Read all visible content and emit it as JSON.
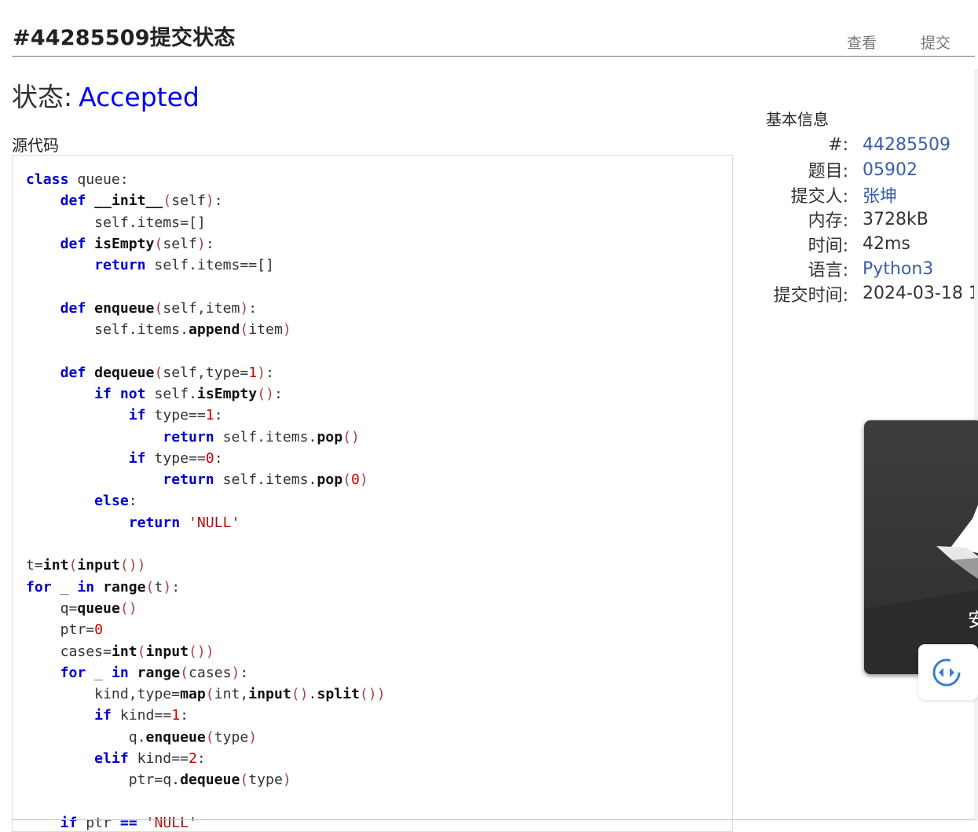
{
  "header": {
    "title": "#44285509提交状态",
    "links": [
      "查看",
      "提交"
    ]
  },
  "status": {
    "label": "状态:",
    "value": "Accepted"
  },
  "source_label": "源代码",
  "info": {
    "title": "基本信息",
    "rows": [
      {
        "label": "#:",
        "value": "44285509",
        "link": true
      },
      {
        "label": "题目:",
        "value": "05902",
        "link": true
      },
      {
        "label": "提交人:",
        "value": "张坤",
        "link": true
      },
      {
        "label": "内存:",
        "value": "3728kB",
        "link": false
      },
      {
        "label": "时间:",
        "value": "42ms",
        "link": false
      },
      {
        "label": "语言:",
        "value": "Python3",
        "link": true
      },
      {
        "label": "提交时间:",
        "value": "2024-03-18 1",
        "link": false
      }
    ]
  },
  "overlay": {
    "partial_text": "安"
  },
  "code_lines": [
    [
      [
        "kw",
        "class"
      ],
      [
        "t",
        " queue:"
      ]
    ],
    [
      [
        "t",
        "    "
      ],
      [
        "kw",
        "def"
      ],
      [
        "t",
        " "
      ],
      [
        "fn",
        "__init__"
      ],
      [
        "p",
        "("
      ],
      [
        "t",
        "self"
      ],
      [
        "p",
        ")"
      ],
      [
        "t",
        ":"
      ]
    ],
    [
      [
        "t",
        "        self.items=[]"
      ]
    ],
    [
      [
        "t",
        "    "
      ],
      [
        "kw",
        "def"
      ],
      [
        "t",
        " "
      ],
      [
        "fn",
        "isEmpty"
      ],
      [
        "p",
        "("
      ],
      [
        "t",
        "self"
      ],
      [
        "p",
        ")"
      ],
      [
        "t",
        ":"
      ]
    ],
    [
      [
        "t",
        "        "
      ],
      [
        "kw",
        "return"
      ],
      [
        "t",
        " self.items==[]"
      ]
    ],
    [
      [
        "t",
        ""
      ]
    ],
    [
      [
        "t",
        "    "
      ],
      [
        "kw",
        "def"
      ],
      [
        "t",
        " "
      ],
      [
        "fn",
        "enqueue"
      ],
      [
        "p",
        "("
      ],
      [
        "t",
        "self,item"
      ],
      [
        "p",
        ")"
      ],
      [
        "t",
        ":"
      ]
    ],
    [
      [
        "t",
        "        self.items."
      ],
      [
        "fn",
        "append"
      ],
      [
        "p",
        "("
      ],
      [
        "t",
        "item"
      ],
      [
        "p",
        ")"
      ]
    ],
    [
      [
        "t",
        ""
      ]
    ],
    [
      [
        "t",
        "    "
      ],
      [
        "kw",
        "def"
      ],
      [
        "t",
        " "
      ],
      [
        "fn",
        "dequeue"
      ],
      [
        "p",
        "("
      ],
      [
        "t",
        "self,type="
      ],
      [
        "num",
        "1"
      ],
      [
        "p",
        ")"
      ],
      [
        "t",
        ":"
      ]
    ],
    [
      [
        "t",
        "        "
      ],
      [
        "kw",
        "if"
      ],
      [
        "t",
        " "
      ],
      [
        "kw",
        "not"
      ],
      [
        "t",
        " self."
      ],
      [
        "fn",
        "isEmpty"
      ],
      [
        "p",
        "()"
      ],
      [
        "t",
        ":"
      ]
    ],
    [
      [
        "t",
        "            "
      ],
      [
        "kw",
        "if"
      ],
      [
        "t",
        " type=="
      ],
      [
        "num",
        "1"
      ],
      [
        "t",
        ":"
      ]
    ],
    [
      [
        "t",
        "                "
      ],
      [
        "kw",
        "return"
      ],
      [
        "t",
        " self.items."
      ],
      [
        "fn",
        "pop"
      ],
      [
        "p",
        "()"
      ]
    ],
    [
      [
        "t",
        "            "
      ],
      [
        "kw",
        "if"
      ],
      [
        "t",
        " type=="
      ],
      [
        "num",
        "0"
      ],
      [
        "t",
        ":"
      ]
    ],
    [
      [
        "t",
        "                "
      ],
      [
        "kw",
        "return"
      ],
      [
        "t",
        " self.items."
      ],
      [
        "fn",
        "pop"
      ],
      [
        "p",
        "("
      ],
      [
        "num",
        "0"
      ],
      [
        "p",
        ")"
      ]
    ],
    [
      [
        "t",
        "        "
      ],
      [
        "kw",
        "else"
      ],
      [
        "t",
        ":"
      ]
    ],
    [
      [
        "t",
        "            "
      ],
      [
        "kw",
        "return"
      ],
      [
        "t",
        " "
      ],
      [
        "str",
        "'NULL'"
      ]
    ],
    [
      [
        "t",
        ""
      ]
    ],
    [
      [
        "t",
        "t="
      ],
      [
        "fn",
        "int"
      ],
      [
        "p",
        "("
      ],
      [
        "fn",
        "input"
      ],
      [
        "p",
        "())"
      ]
    ],
    [
      [
        "kw",
        "for"
      ],
      [
        "t",
        " _ "
      ],
      [
        "kw",
        "in"
      ],
      [
        "t",
        " "
      ],
      [
        "fn",
        "range"
      ],
      [
        "p",
        "("
      ],
      [
        "t",
        "t"
      ],
      [
        "p",
        ")"
      ],
      [
        "t",
        ":"
      ]
    ],
    [
      [
        "t",
        "    q="
      ],
      [
        "fn",
        "queue"
      ],
      [
        "p",
        "()"
      ]
    ],
    [
      [
        "t",
        "    ptr="
      ],
      [
        "num",
        "0"
      ]
    ],
    [
      [
        "t",
        "    cases="
      ],
      [
        "fn",
        "int"
      ],
      [
        "p",
        "("
      ],
      [
        "fn",
        "input"
      ],
      [
        "p",
        "())"
      ]
    ],
    [
      [
        "t",
        "    "
      ],
      [
        "kw",
        "for"
      ],
      [
        "t",
        " _ "
      ],
      [
        "kw",
        "in"
      ],
      [
        "t",
        " "
      ],
      [
        "fn",
        "range"
      ],
      [
        "p",
        "("
      ],
      [
        "t",
        "cases"
      ],
      [
        "p",
        ")"
      ],
      [
        "t",
        ":"
      ]
    ],
    [
      [
        "t",
        "        kind,type="
      ],
      [
        "fn",
        "map"
      ],
      [
        "p",
        "("
      ],
      [
        "t",
        "int,"
      ],
      [
        "fn",
        "input"
      ],
      [
        "p",
        "()"
      ],
      [
        "t",
        "."
      ],
      [
        "fn",
        "split"
      ],
      [
        "p",
        "())"
      ]
    ],
    [
      [
        "t",
        "        "
      ],
      [
        "kw",
        "if"
      ],
      [
        "t",
        " kind=="
      ],
      [
        "num",
        "1"
      ],
      [
        "t",
        ":"
      ]
    ],
    [
      [
        "t",
        "            q."
      ],
      [
        "fn",
        "enqueue"
      ],
      [
        "p",
        "("
      ],
      [
        "t",
        "type"
      ],
      [
        "p",
        ")"
      ]
    ],
    [
      [
        "t",
        "        "
      ],
      [
        "kw",
        "elif"
      ],
      [
        "t",
        " kind=="
      ],
      [
        "num",
        "2"
      ],
      [
        "t",
        ":"
      ]
    ],
    [
      [
        "t",
        "            ptr=q."
      ],
      [
        "fn",
        "dequeue"
      ],
      [
        "p",
        "("
      ],
      [
        "t",
        "type"
      ],
      [
        "p",
        ")"
      ]
    ],
    [
      [
        "t",
        ""
      ]
    ],
    [
      [
        "t",
        "    "
      ],
      [
        "kw",
        "if"
      ],
      [
        "t",
        " ptr "
      ],
      [
        "kw",
        "=="
      ],
      [
        "t",
        " "
      ],
      [
        "str",
        "'NULL'"
      ]
    ]
  ]
}
